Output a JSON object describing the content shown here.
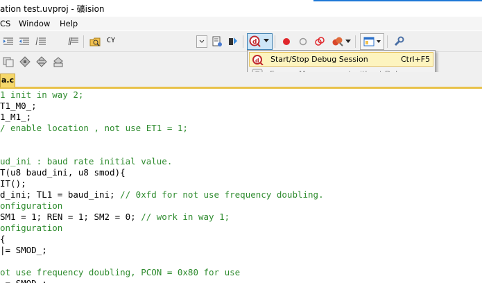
{
  "window": {
    "title": "ation test.uvproj - 礦ision"
  },
  "menubar": {
    "items": [
      "CS",
      "Window",
      "Help"
    ]
  },
  "toolbar": {
    "target_combo": "CY"
  },
  "debug_menu": {
    "items": [
      {
        "label": "Start/Stop Debug Session",
        "shortcut": "Ctrl+F5",
        "highlighted": true,
        "enabled": true
      },
      {
        "label": "Energy Measurement without Debug",
        "shortcut": "",
        "highlighted": false,
        "enabled": false
      }
    ]
  },
  "file_tab": {
    "label": "a.c"
  },
  "editor": {
    "lines": [
      {
        "code": "",
        "comment": "1 init in way 2;"
      },
      {
        "code": "T1_M0_;",
        "comment": ""
      },
      {
        "code": "1_M1_;",
        "comment": ""
      },
      {
        "code": "",
        "comment": "/ enable location , not use ET1 = 1;"
      },
      {
        "code": "",
        "comment": ""
      },
      {
        "code": "",
        "comment": ""
      },
      {
        "code": "",
        "comment": "ud_ini : baud rate initial value."
      },
      {
        "code": "T(u8 baud_ini, u8 smod){",
        "comment": ""
      },
      {
        "code": "IT();",
        "comment": ""
      },
      {
        "code": "d_ini; TL1 = baud_ini; ",
        "comment": "// 0xfd for not use frequency doubling."
      },
      {
        "code": "",
        "comment": "onfiguration"
      },
      {
        "code": "SM1 = 1; REN = 1; SM2 = 0; ",
        "comment": "// work in way 1;"
      },
      {
        "code": "",
        "comment": "onfiguration"
      },
      {
        "code": "{",
        "comment": ""
      },
      {
        "code": "|= SMOD_;",
        "comment": ""
      },
      {
        "code": "",
        "comment": ""
      },
      {
        "code": "",
        "comment": "ot use frequency doubling, PCON = 0x80 for use"
      },
      {
        "code": " = SMOD ;",
        "comment": ""
      }
    ]
  },
  "colors": {
    "comment": "#2e8b2e",
    "highlight": "#fdf4bf",
    "tab": "#f6d86b"
  }
}
